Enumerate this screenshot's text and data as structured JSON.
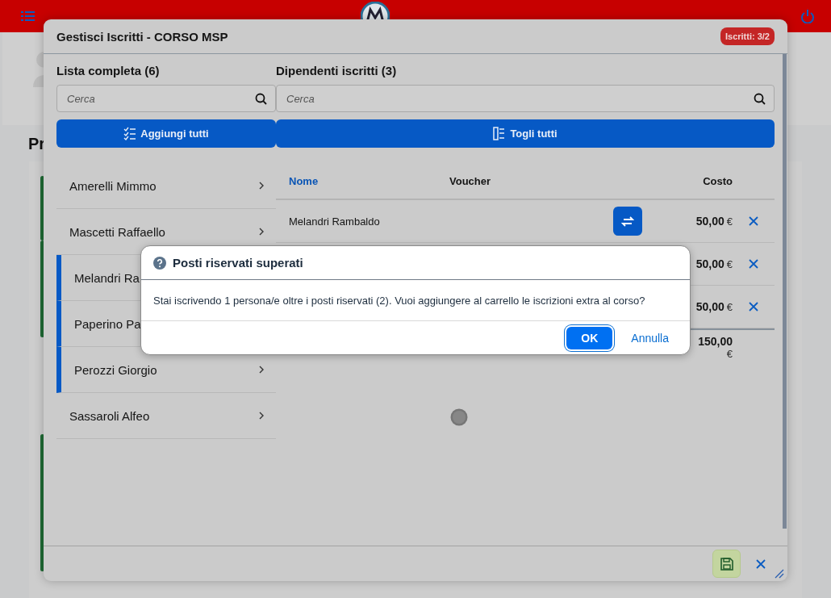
{
  "page": {
    "heading": "Pr"
  },
  "dialog": {
    "title": "Gestisci Iscritti - CORSO MSP",
    "badge": "Iscritti: 3/2",
    "full_list": {
      "heading": "Lista completa (6)",
      "search": {
        "placeholder": "Cerca"
      },
      "add_all": "Aggiungi tutti",
      "items": [
        {
          "label": "Amerelli Mimmo",
          "selected": false,
          "chevron": true
        },
        {
          "label": "Mascetti Raffaello",
          "selected": false,
          "chevron": true
        },
        {
          "label": "Melandri Ra",
          "selected": true,
          "chevron": false
        },
        {
          "label": "Paperino Pa",
          "selected": true,
          "chevron": false
        },
        {
          "label": "Perozzi Giorgio",
          "selected": true,
          "chevron": true
        },
        {
          "label": "Sassaroli Alfeo",
          "selected": false,
          "chevron": true
        }
      ]
    },
    "enrolled": {
      "heading": "Dipendenti iscritti (3)",
      "search": {
        "placeholder": "Cerca"
      },
      "remove_all": "Togli tutti",
      "columns": [
        "Nome",
        "Voucher",
        "Costo"
      ],
      "rows": [
        {
          "name": "Melandri Rambaldo",
          "voucher": true,
          "cost": "50,00",
          "currency": "€"
        },
        {
          "voucher": false,
          "cost": "50,00",
          "currency": "€"
        },
        {
          "voucher": false,
          "cost": "50,00",
          "currency": "€"
        }
      ],
      "total": {
        "cost": "150,00",
        "currency": "€"
      }
    },
    "busy": true
  },
  "message_box": {
    "title": "Posti riservati superati",
    "text": "Stai iscrivendo 1 persona/e oltre i posti riservati (2). Vuoi aggiungere al carrello le iscrizioni extra al corso?",
    "buttons": [
      {
        "label": "OK",
        "kind": "emphasized"
      },
      {
        "label": "Annulla",
        "kind": "transparent"
      }
    ]
  }
}
